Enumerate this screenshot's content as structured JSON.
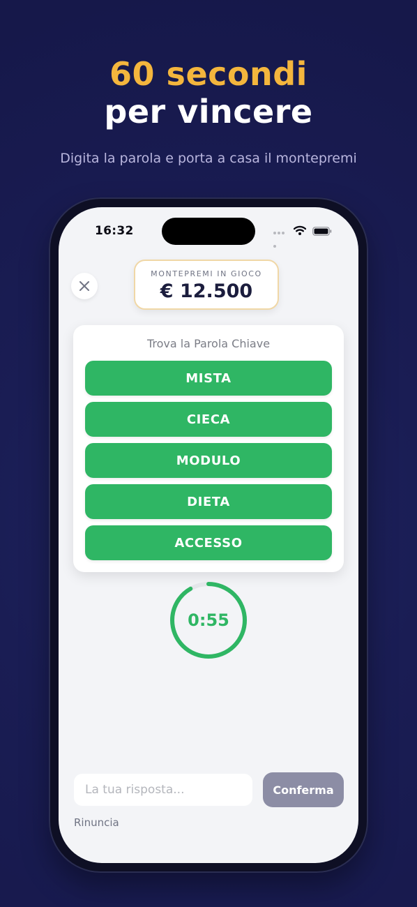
{
  "promo": {
    "headline_line1": "60 secondi",
    "headline_line2": "per vincere",
    "subtitle": "Digita la parola e porta a casa il montepremi",
    "accent_color": "#f4b63d",
    "background_color": "#1a1d54"
  },
  "status_bar": {
    "time": "16:32",
    "icons": [
      "signal-dots-icon",
      "wifi-icon",
      "battery-icon"
    ]
  },
  "header": {
    "close_icon": "close-icon",
    "prize_label": "MONTEPREMI IN GIOCO",
    "prize_value": "€ 12.500"
  },
  "game": {
    "title": "Trova la Parola Chiave",
    "words": [
      "MISTA",
      "CIECA",
      "MODULO",
      "DIETA",
      "ACCESSO"
    ],
    "word_color": "#2fb664"
  },
  "timer": {
    "label": "0:55",
    "remaining_seconds": 55,
    "total_seconds": 60,
    "progress_fraction": 0.9167
  },
  "answer": {
    "placeholder": "La tua risposta...",
    "value": "",
    "confirm_label": "Conferma",
    "give_up_label": "Rinuncia"
  }
}
